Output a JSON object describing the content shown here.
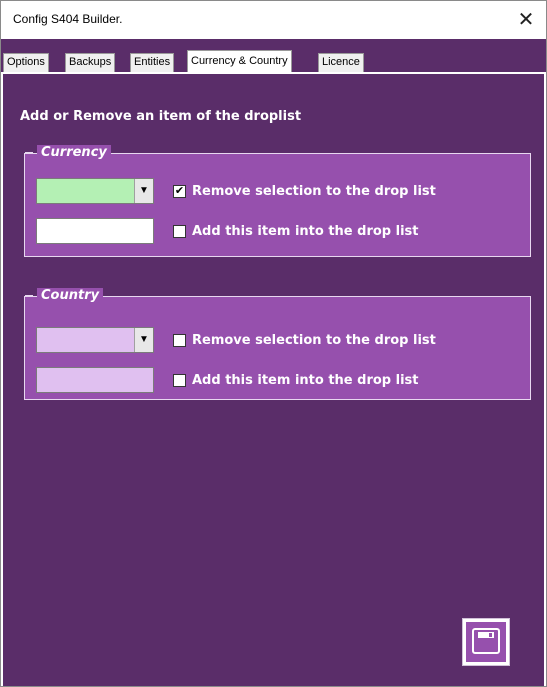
{
  "window": {
    "title": "Config S404 Builder.",
    "close_symbol": "✕"
  },
  "tabs": [
    {
      "label": "Options",
      "active": false
    },
    {
      "label": "Backups",
      "active": false
    },
    {
      "label": "Entities",
      "active": false
    },
    {
      "label": "Currency & Country",
      "active": true
    },
    {
      "label": "Licence",
      "active": false
    }
  ],
  "page": {
    "heading": "Add or Remove an item of the droplist"
  },
  "currency": {
    "legend": "Currency",
    "combo_value": "",
    "combo_color": "#b4f0b4",
    "textbox_value": "",
    "textbox_color": "#ffffff",
    "remove_label": "Remove selection to the drop list",
    "remove_checked": true,
    "add_label": "Add this item into the drop list",
    "add_checked": false
  },
  "country": {
    "legend": "Country",
    "combo_value": "",
    "combo_color": "#e0c0f0",
    "textbox_value": "",
    "textbox_color": "#e0c0f0",
    "remove_label": "Remove selection to the drop list",
    "remove_checked": false,
    "add_label": "Add this item into the drop list",
    "add_checked": false
  },
  "icons": {
    "close": "close-icon",
    "dropdown": "dropdown-arrow-icon",
    "save": "save-floppy-icon"
  },
  "colors": {
    "background": "#5a2d69",
    "group": "#9650ad",
    "text": "#ffffff"
  }
}
